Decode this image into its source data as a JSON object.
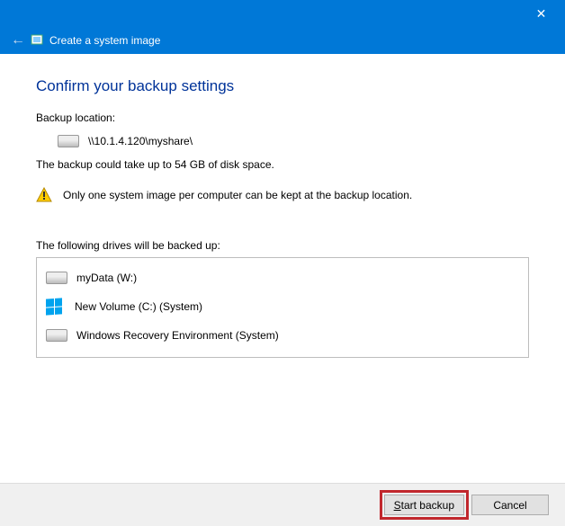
{
  "window": {
    "close_glyph": "✕",
    "back_glyph": "←",
    "title": "Create a system image"
  },
  "heading": "Confirm your backup settings",
  "backup_location_label": "Backup location:",
  "backup_location_value": "\\\\10.1.4.120\\myshare\\",
  "size_message": "The backup could take up to 54 GB of disk space.",
  "warning_message": "Only one system image per computer can be kept at the backup location.",
  "drives_label": "The following drives will be backed up:",
  "drives": [
    {
      "icon": "hdd",
      "name": "myData (W:)"
    },
    {
      "icon": "win",
      "name": "New Volume (C:) (System)"
    },
    {
      "icon": "hdd",
      "name": "Windows Recovery Environment (System)"
    }
  ],
  "buttons": {
    "start_u": "S",
    "start_rest": "tart backup",
    "cancel": "Cancel"
  }
}
